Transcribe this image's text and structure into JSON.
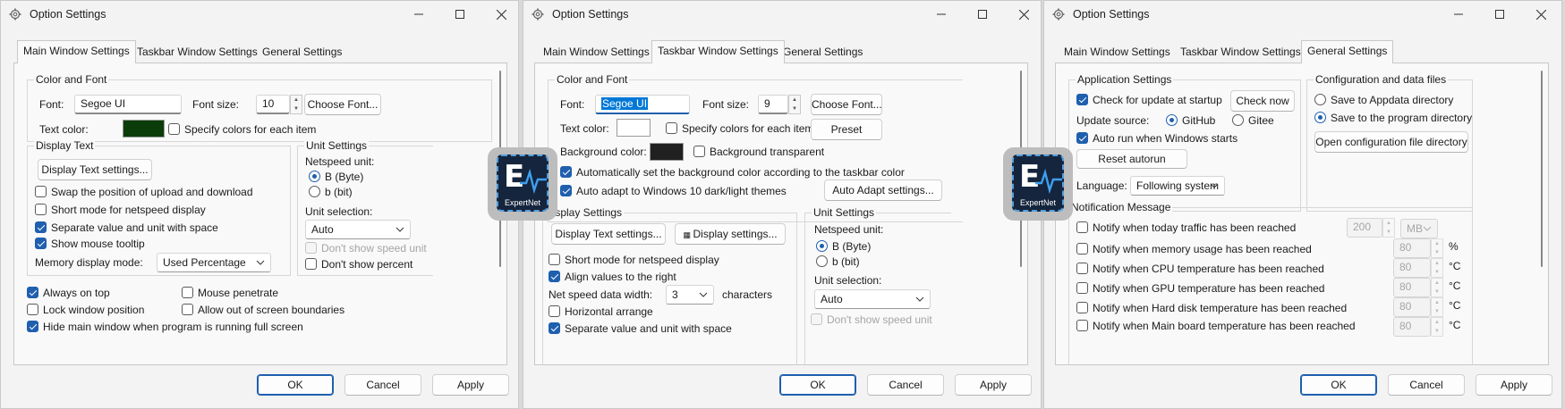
{
  "window_title": "Option Settings",
  "tabs": [
    "Main Window Settings",
    "Taskbar Window Settings",
    "General Settings"
  ],
  "dialog_buttons": {
    "ok": "OK",
    "cancel": "Cancel",
    "apply": "Apply"
  },
  "app_icon": {
    "letter": "E",
    "label": "ExpertNet"
  },
  "main": {
    "color_font": {
      "group": "Color and Font",
      "font_label": "Font:",
      "font_value": "Segoe UI",
      "size_label": "Font size:",
      "size_value": "10",
      "choose_font": "Choose Font...",
      "text_color_label": "Text color:",
      "text_color": "#0b3d0b",
      "specify_colors": "Specify colors for each item"
    },
    "display_text": {
      "group": "Display Text",
      "settings_button": "Display Text settings...",
      "swap": "Swap the position of upload and download",
      "short_mode": "Short mode for netspeed display",
      "separate": "Separate value and unit with space",
      "tooltip": "Show mouse tooltip",
      "memory_label": "Memory display mode:",
      "memory_value": "Used Percentage"
    },
    "unit_settings": {
      "group": "Unit Settings",
      "netspeed_label": "Netspeed unit:",
      "byte": "B (Byte)",
      "bit": "b (bit)",
      "selection_label": "Unit selection:",
      "selection_value": "Auto",
      "dont_show_speed": "Don't show speed unit",
      "dont_show_percent": "Don't show percent"
    },
    "bottom": {
      "always_on_top": "Always on top",
      "mouse_penetrate": "Mouse penetrate",
      "lock_position": "Lock window position",
      "allow_out": "Allow out of screen boundaries",
      "hide_main": "Hide main window when program is running full screen"
    }
  },
  "taskbar": {
    "color_font": {
      "group": "Color and Font",
      "font_label": "Font:",
      "font_value": "Segoe UI",
      "size_label": "Font size:",
      "size_value": "9",
      "choose_font": "Choose Font...",
      "text_color_label": "Text color:",
      "text_color": "#ffffff",
      "specify_colors": "Specify colors for each item",
      "preset": "Preset",
      "bg_color_label": "Background color:",
      "bg_color": "#202020",
      "bg_transparent": "Background transparent",
      "auto_bg": "Automatically set the background color according to the taskbar color",
      "auto_adapt": "Auto adapt to Windows 10 dark/light themes",
      "auto_adapt_button": "Auto Adapt settings..."
    },
    "display_settings": {
      "group": "Display Settings",
      "text_button": "Display Text settings...",
      "display_button": "Display settings...",
      "short_mode": "Short mode for netspeed display",
      "align_right": "Align values to the right",
      "width_label": "Net speed data width:",
      "width_value": "3",
      "width_unit": "characters",
      "horizontal": "Horizontal arrange",
      "separate": "Separate value and unit with space"
    },
    "unit_settings": {
      "group": "Unit Settings",
      "netspeed_label": "Netspeed unit:",
      "byte": "B (Byte)",
      "bit": "b (bit)",
      "selection_label": "Unit selection:",
      "selection_value": "Auto",
      "dont_show_speed": "Don't show speed unit"
    }
  },
  "general": {
    "app_settings": {
      "group": "Application Settings",
      "check_update": "Check for update at startup",
      "check_now": "Check now",
      "update_source_label": "Update source:",
      "github": "GitHub",
      "gitee": "Gitee",
      "auto_run": "Auto run when Windows starts",
      "reset_autorun": "Reset autorun",
      "language_label": "Language:",
      "language_value": "Following system"
    },
    "config": {
      "group": "Configuration and data files",
      "appdata": "Save to Appdata directory",
      "program_dir": "Save to the program directory",
      "open_dir": "Open configuration file directory"
    },
    "notification": {
      "group": "Notification Message",
      "items": [
        {
          "label": "Notify when today traffic has been reached",
          "value": "200",
          "unit": "MB"
        },
        {
          "label": "Notify when memory usage has been reached",
          "value": "80",
          "unit": "%"
        },
        {
          "label": "Notify when CPU temperature has been reached",
          "value": "80",
          "unit": "°C"
        },
        {
          "label": "Notify when GPU temperature has been reached",
          "value": "80",
          "unit": "°C"
        },
        {
          "label": "Notify when Hard disk temperature has been reached",
          "value": "80",
          "unit": "°C"
        },
        {
          "label": "Notify when Main board temperature has been reached",
          "value": "80",
          "unit": "°C"
        }
      ]
    }
  }
}
